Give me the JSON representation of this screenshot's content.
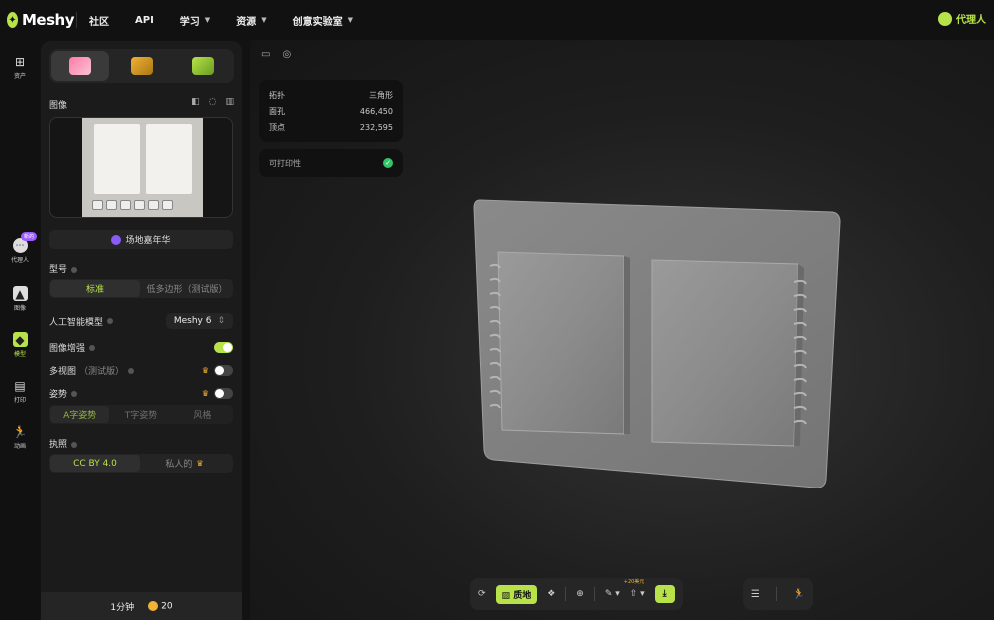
{
  "topbar": {
    "brand": "Meshy",
    "nav": [
      {
        "label": "社区",
        "dropdown": false
      },
      {
        "label": "API",
        "dropdown": false
      },
      {
        "label": "学习",
        "dropdown": true
      },
      {
        "label": "资源",
        "dropdown": true
      },
      {
        "label": "创意实验室",
        "dropdown": true
      }
    ],
    "agent_label": "代理人"
  },
  "rail": {
    "items": [
      {
        "label": "资产",
        "icon": "grid-icon"
      },
      {
        "label": "代理人",
        "icon": "agent-chat-icon",
        "badge": "新的"
      },
      {
        "label": "图像",
        "icon": "image-icon"
      },
      {
        "label": "模型",
        "icon": "cube-icon"
      },
      {
        "label": "打印",
        "icon": "printer-icon"
      },
      {
        "label": "动画",
        "icon": "running-figure-icon"
      }
    ]
  },
  "panel": {
    "image_section_title": "图像",
    "scene_button": "场地嘉年华",
    "model_type": {
      "title": "型号",
      "options": [
        "标准",
        "低多边形（测试版）"
      ],
      "selected_index": 0
    },
    "ai_model": {
      "label": "人工智能模型",
      "value": "Meshy 6"
    },
    "image_enhance": {
      "label": "图像增强",
      "on": true
    },
    "multiview": {
      "label": "多视图",
      "suffix": "（测试版）",
      "on": false
    },
    "pose": {
      "label": "姿势",
      "on": false,
      "options": [
        "A字姿势",
        "T字姿势",
        "风格"
      ],
      "selected_index": 0
    },
    "license": {
      "title": "执照",
      "options": [
        "CC BY 4.0",
        "私人的"
      ],
      "selected_index": 0
    },
    "footer": {
      "time": "1分钟",
      "credits": "20"
    }
  },
  "viewport": {
    "stats": [
      {
        "label": "拓扑",
        "value": "三角形"
      },
      {
        "label": "面孔",
        "value": "466,450"
      },
      {
        "label": "顶点",
        "value": "232,595"
      }
    ],
    "printable_label": "可打印性",
    "toolbar": {
      "texture_label": "质地",
      "cost_label": "+20美元"
    }
  },
  "colors": {
    "accent": "#b7e24a",
    "panel": "#1b1b1b",
    "background": "#121212"
  }
}
